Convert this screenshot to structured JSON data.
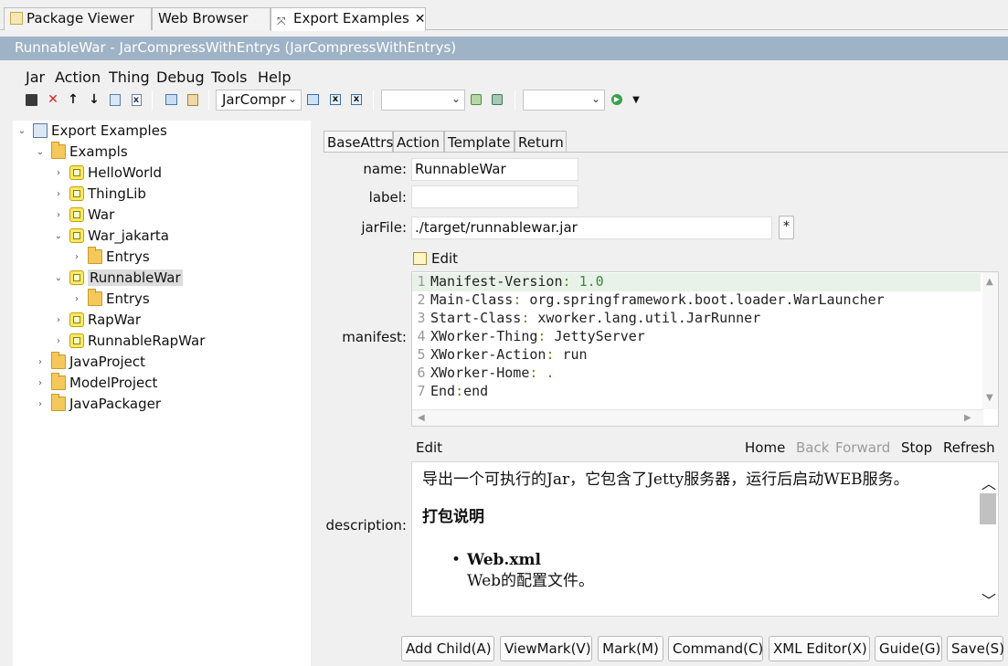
{
  "top_tabs": [
    {
      "label": "Package Viewer",
      "icon": "package-viewer-icon"
    },
    {
      "label": "Web Browser",
      "icon": ""
    },
    {
      "label": "Export Examples",
      "icon": "export-icon",
      "close": "✕"
    }
  ],
  "title_bar": "RunnableWar - JarCompressWithEntrys  (JarCompressWithEntrys)",
  "menu": [
    "Jar",
    "Action",
    "Thing",
    "Debug",
    "Tools",
    "Help"
  ],
  "toolbar": {
    "combo1_value": "JarCompr",
    "combo2_value": "",
    "combo3_value": ""
  },
  "tree": [
    {
      "label": "Export Examples",
      "level": 0,
      "expanded": true,
      "icon": "monitor-icon"
    },
    {
      "label": "Exampls",
      "level": 1,
      "expanded": true,
      "icon": "folder-icon"
    },
    {
      "label": "HelloWorld",
      "level": 2,
      "expanded": false,
      "icon": "thing-icon"
    },
    {
      "label": "ThingLib",
      "level": 2,
      "expanded": false,
      "icon": "thing-icon"
    },
    {
      "label": "War",
      "level": 2,
      "expanded": false,
      "icon": "thing-icon"
    },
    {
      "label": "War_jakarta",
      "level": 2,
      "expanded": true,
      "icon": "thing-icon"
    },
    {
      "label": "Entrys",
      "level": 3,
      "expanded": false,
      "icon": "folder-icon"
    },
    {
      "label": "RunnableWar",
      "level": 2,
      "expanded": true,
      "icon": "thing-icon",
      "selected": true
    },
    {
      "label": "Entrys",
      "level": 3,
      "expanded": false,
      "icon": "folder-icon"
    },
    {
      "label": "RapWar",
      "level": 2,
      "expanded": false,
      "icon": "thing-icon"
    },
    {
      "label": "RunnableRapWar",
      "level": 2,
      "expanded": false,
      "icon": "thing-icon"
    },
    {
      "label": "JavaProject",
      "level": 1,
      "expanded": false,
      "icon": "folder-icon"
    },
    {
      "label": "ModelProject",
      "level": 1,
      "expanded": false,
      "icon": "folder-icon"
    },
    {
      "label": "JavaPackager",
      "level": 1,
      "expanded": false,
      "icon": "folder-icon"
    }
  ],
  "editor_tabs": [
    "BaseAttrs",
    "Action",
    "Template",
    "Return"
  ],
  "fields": {
    "name_label": "name:",
    "name_value": "RunnableWar",
    "label_label": "label:",
    "label_value": "",
    "jarfile_label": "jarFile:",
    "jarfile_value": "./target/runnablewar.jar",
    "jarfile_button": "*",
    "edit_label": "Edit",
    "manifest_label": "manifest:",
    "description_label": "description:"
  },
  "manifest_lines": [
    {
      "n": "1",
      "key": "Manifest-Version",
      "val": "1.0",
      "num": true
    },
    {
      "n": "2",
      "key": "Main-Class",
      "val": "org.springframework.boot.loader.WarLauncher"
    },
    {
      "n": "3",
      "key": "Start-Class",
      "val": "xworker.lang.util.JarRunner"
    },
    {
      "n": "4",
      "key": "XWorker-Thing",
      "val": "JettyServer"
    },
    {
      "n": "5",
      "key": "XWorker-Action",
      "val": "run"
    },
    {
      "n": "6",
      "key": "XWorker-Home",
      "val": ".",
      "num": true
    },
    {
      "n": "7",
      "key": "End",
      "val": "end"
    }
  ],
  "desc_toolbar": {
    "edit": "Edit",
    "home": "Home",
    "back": "Back",
    "forward": "Forward",
    "stop": "Stop",
    "refresh": "Refresh"
  },
  "description": {
    "para": "导出一个可执行的Jar，它包含了Jetty服务器，运行后启动WEB服务。",
    "heading": "打包说明",
    "item_title": "Web.xml",
    "item_text": "Web的配置文件。"
  },
  "buttons": [
    "Add Child(A)",
    "ViewMark(V)",
    "Mark(M)",
    "Command(C)",
    "XML Editor(X)",
    "Guide(G)",
    "Save(S)"
  ],
  "colors": {
    "title_bar_bg": "#9eb3c6",
    "selected_bg": "#dcdcdc",
    "current_line_bg": "#e8f2e8"
  }
}
